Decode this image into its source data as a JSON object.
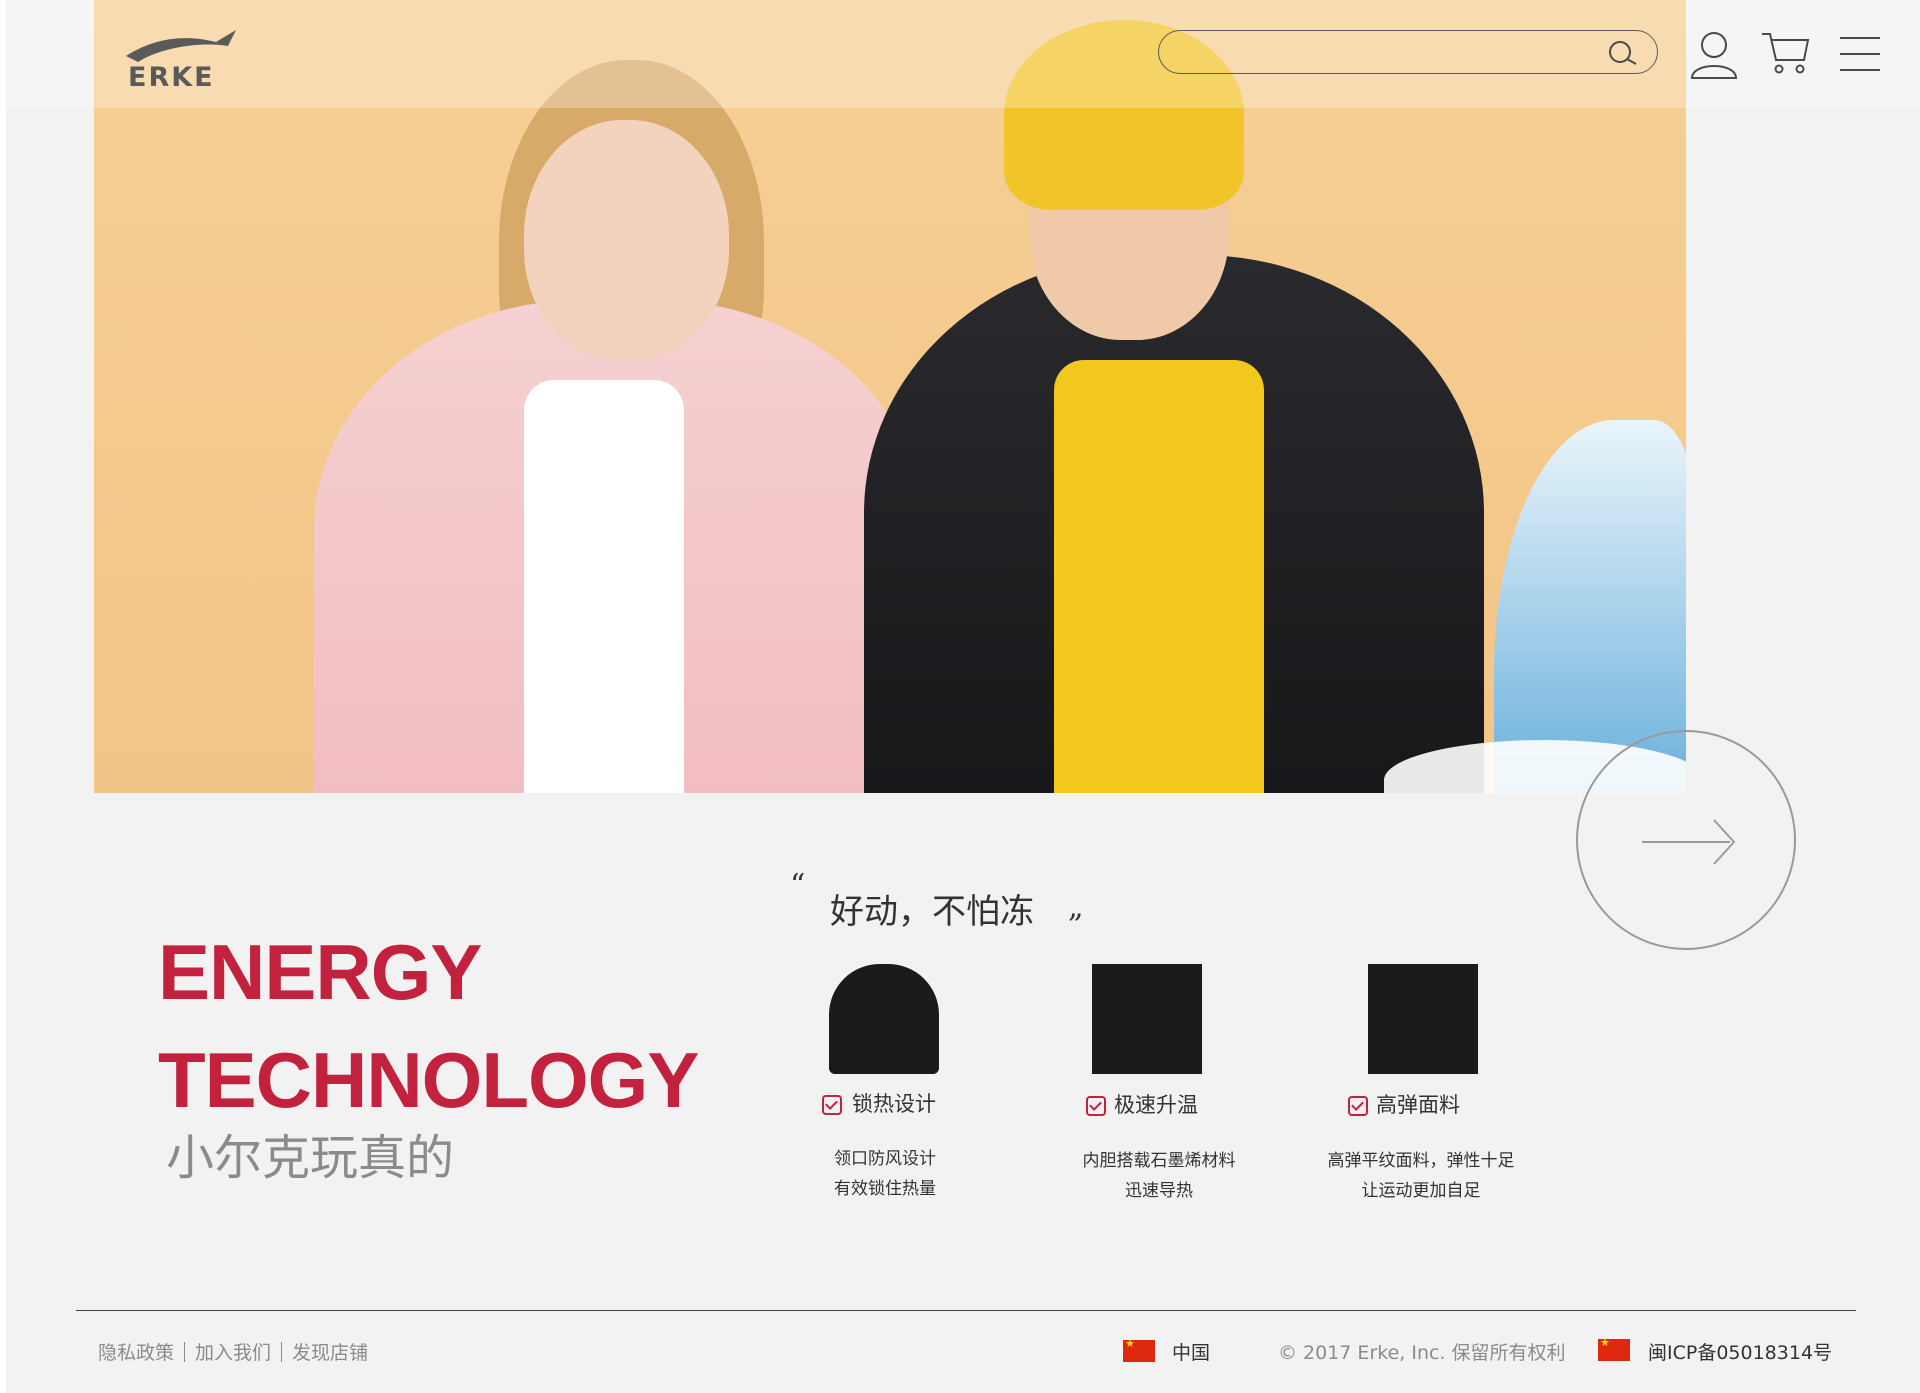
{
  "header": {
    "logo_text": "ERKE",
    "search": {
      "value": "",
      "placeholder": ""
    },
    "icons": [
      "search-icon",
      "user-icon",
      "cart-icon",
      "menu-icon"
    ]
  },
  "hero": {
    "next_icon": "arrow-right-icon"
  },
  "content": {
    "headline_line1": "ENERGY",
    "headline_line2": "TECHNOLOGY",
    "subhead": "小尔克玩真的",
    "quote_open": "“",
    "quote_text": "好动，不怕冻",
    "quote_close": "„",
    "features": [
      {
        "title": "锁热设计",
        "desc_line1": "领口防风设计",
        "desc_line2": "有效锁住热量"
      },
      {
        "title": "极速升温",
        "desc_line1": "内胆搭载石墨烯材料",
        "desc_line2": "迅速导热"
      },
      {
        "title": "高弹面料",
        "desc_line1": "高弹平纹面料，弹性十足",
        "desc_line2": "让运动更加自足"
      }
    ]
  },
  "footer": {
    "links": [
      "隐私政策",
      "加入我们",
      "发现店铺"
    ],
    "region": "中国",
    "copyright": "© 2017 Erke, Inc. 保留所有权利",
    "icp": "闽ICP备05018314号"
  },
  "colors": {
    "accent_red": "#c2223d",
    "page_bg": "#f2f2f2",
    "hero_bg": "#f4c98c",
    "text_gray": "#8b8b8b"
  }
}
